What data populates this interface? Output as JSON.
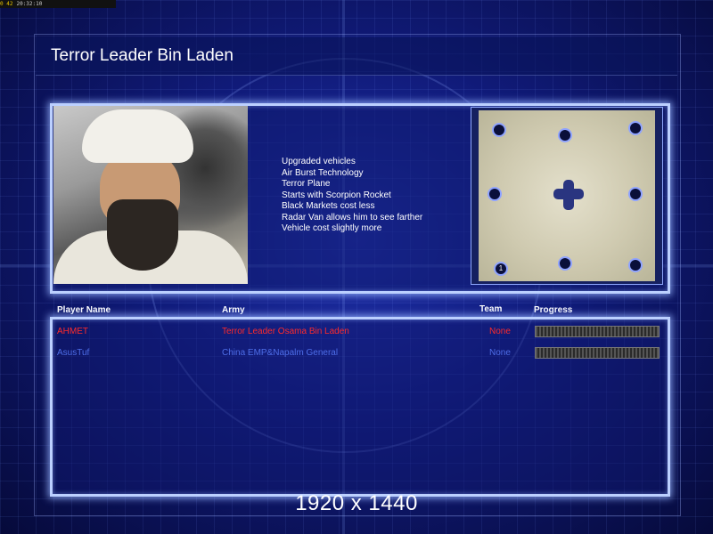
{
  "hud": {
    "fps": "0 42",
    "time": "20:32:10"
  },
  "title": "Terror Leader Bin Laden",
  "features": [
    "Upgraded vehicles",
    "Air Burst Technology",
    "Terror Plane",
    "Starts with Scorpion Rocket",
    "Black Markets cost less",
    "Radar Van allows him to see farther",
    "Vehicle cost slightly more"
  ],
  "minimap": {
    "start_label": "1"
  },
  "columns": {
    "player_name": "Player Name",
    "army": "Army",
    "team": "Team",
    "progress": "Progress"
  },
  "players": [
    {
      "name": "AHMET",
      "army": "Terror Leader Osama Bin Laden",
      "team": "None",
      "color": "#ff2a2a",
      "progress": 0
    },
    {
      "name": "AsusTuf",
      "army": "China EMP&Napalm General",
      "team": "None",
      "color": "#4e6ee8",
      "progress": 0
    }
  ],
  "resolution": "1920 x 1440"
}
